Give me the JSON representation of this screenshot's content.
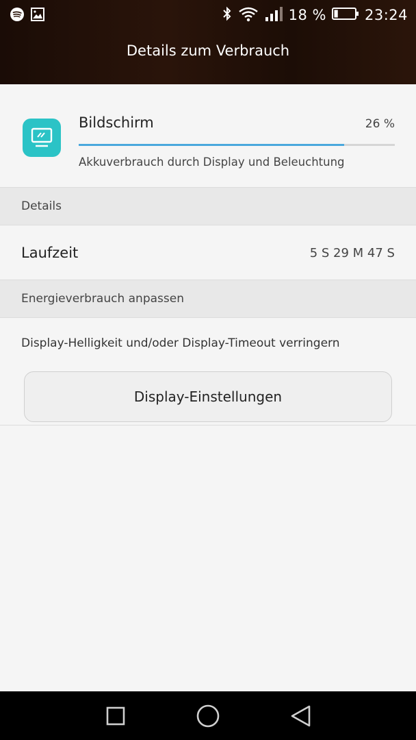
{
  "status_bar": {
    "battery_percent": "18 %",
    "battery_level": 0.18,
    "time": "23:24",
    "icons_left": [
      "spotify-icon",
      "image-icon"
    ],
    "icons_right": [
      "bluetooth-icon",
      "wifi-icon",
      "signal-icon",
      "battery-icon"
    ]
  },
  "header": {
    "title": "Details zum Verbrauch"
  },
  "app": {
    "icon": "monitor-icon",
    "icon_color": "#2bc3c6",
    "name": "Bildschirm",
    "percent_label": "26 %",
    "usage_fraction": 0.84,
    "bar_color": "#4aa8dd",
    "description": "Akkuverbrauch durch Display und Beleuchtung"
  },
  "sections": {
    "details": "Details",
    "adjust": "Energieverbrauch anpassen"
  },
  "runtime": {
    "label": "Laufzeit",
    "value": "5 S 29 M 47 S"
  },
  "adjust": {
    "hint": "Display-Helligkeit und/oder Display-Timeout verringern",
    "button_label": "Display-Einstellungen"
  },
  "nav_bar": {
    "icons": [
      "recents-icon",
      "home-icon",
      "back-icon"
    ]
  }
}
